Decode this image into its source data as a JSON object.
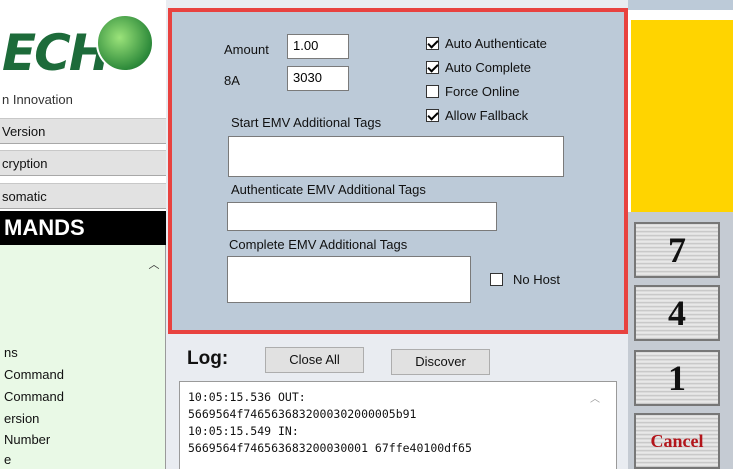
{
  "left_panel": {
    "logo_text": "ECH",
    "logo_subtitle": "n Innovation",
    "buttons": [
      {
        "label": "Version"
      },
      {
        "label": "cryption"
      },
      {
        "label": "somatic"
      }
    ],
    "commands_header": "MANDS",
    "command_items": [
      {
        "label": "ns"
      },
      {
        "label": "Command"
      },
      {
        "label": "Command"
      },
      {
        "label": "ersion"
      },
      {
        "label": "Number"
      },
      {
        "label": "e"
      }
    ]
  },
  "config": {
    "amount_label": "Amount",
    "amount_value": "1.00",
    "tag_8a_label": "8A",
    "tag_8a_value": "3030",
    "checkboxes": [
      {
        "label": "Auto Authenticate",
        "checked": true
      },
      {
        "label": "Auto Complete",
        "checked": true
      },
      {
        "label": "Force Online",
        "checked": false
      },
      {
        "label": "Allow Fallback",
        "checked": true
      }
    ],
    "start_tags_label": "Start EMV Additional Tags",
    "start_tags_value": "",
    "auth_tags_label": "Authenticate EMV Additional Tags",
    "auth_tags_value": "",
    "complete_tags_label": "Complete EMV Additional Tags",
    "complete_tags_value": "",
    "no_host_label": "No Host",
    "no_host_checked": false,
    "border_color": "#e8423f"
  },
  "log": {
    "label": "Log:",
    "close_all_label": "Close All",
    "discover_label": "Discover",
    "lines": [
      "10:05:15.536 OUT:",
      "5669564f7465636832000302000005b91",
      "10:05:15.549 IN:",
      "5669564f746563683200030001 67ffe40100df65"
    ]
  },
  "keypad": {
    "keys": [
      "7",
      "4",
      "1"
    ],
    "cancel_label": "Cancel",
    "accent_yellow": "#ffd400",
    "cancel_color": "#b3151b"
  }
}
